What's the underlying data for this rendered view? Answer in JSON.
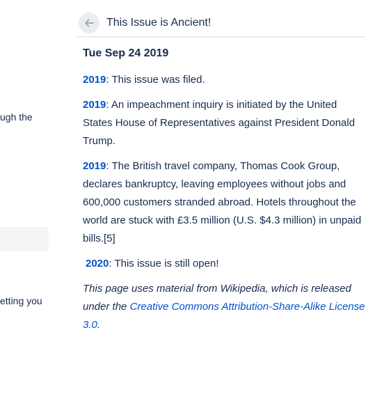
{
  "background": {
    "frag1": "ugh the",
    "frag2": "etting you"
  },
  "header": {
    "title": "This Issue is Ancient!",
    "back_icon": "arrow-left-icon"
  },
  "date": "Tue Sep 24 2019",
  "entries": [
    {
      "year": "2019",
      "text": ": This issue was filed."
    },
    {
      "year": "2019",
      "text": ": An impeachment inquiry is initiated by the United States House of Representatives against President Donald Trump."
    },
    {
      "year": "2019",
      "text": ": The British travel company, Thomas Cook Group, declares bankruptcy, leaving employees without jobs and 600,000 customers stranded abroad. Hotels throughout the world are stuck with £3.5 million (U.S. $4.3 million) in unpaid bills.[5]"
    },
    {
      "year": "2020",
      "text": ": This issue is still open!"
    }
  ],
  "note": {
    "prefix": "This page uses material from Wikipedia, which is released under the ",
    "link": "Creative Commons Attribution-Share-Alike License 3.0",
    "suffix": "."
  },
  "colors": {
    "link": "#0052cc",
    "text": "#172b4d",
    "divider": "#ebecf0"
  }
}
